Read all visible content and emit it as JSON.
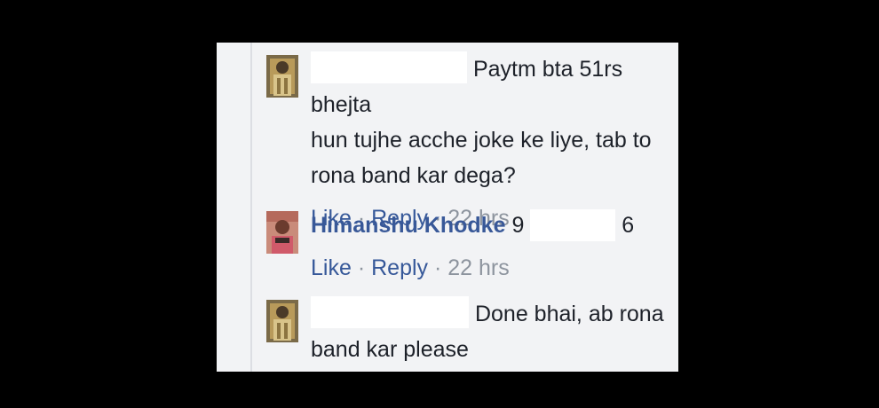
{
  "comments": [
    {
      "author": "",
      "text_line1": "Paytm bta 51rs bhejta",
      "text_rest": "hun tujhe acche joke ke liye, tab to rona band kar dega?",
      "like": "Like",
      "reply": "Reply",
      "sep": "·",
      "time": "22 hrs"
    },
    {
      "author": "Himanshu Khodke",
      "text_prefix": "9",
      "text_suffix": "6",
      "like": "Like",
      "reply": "Reply",
      "sep": "·",
      "time": "22 hrs"
    },
    {
      "author": "",
      "text_line1": "Done bhai, ab rona",
      "text_rest": "band kar please"
    }
  ]
}
